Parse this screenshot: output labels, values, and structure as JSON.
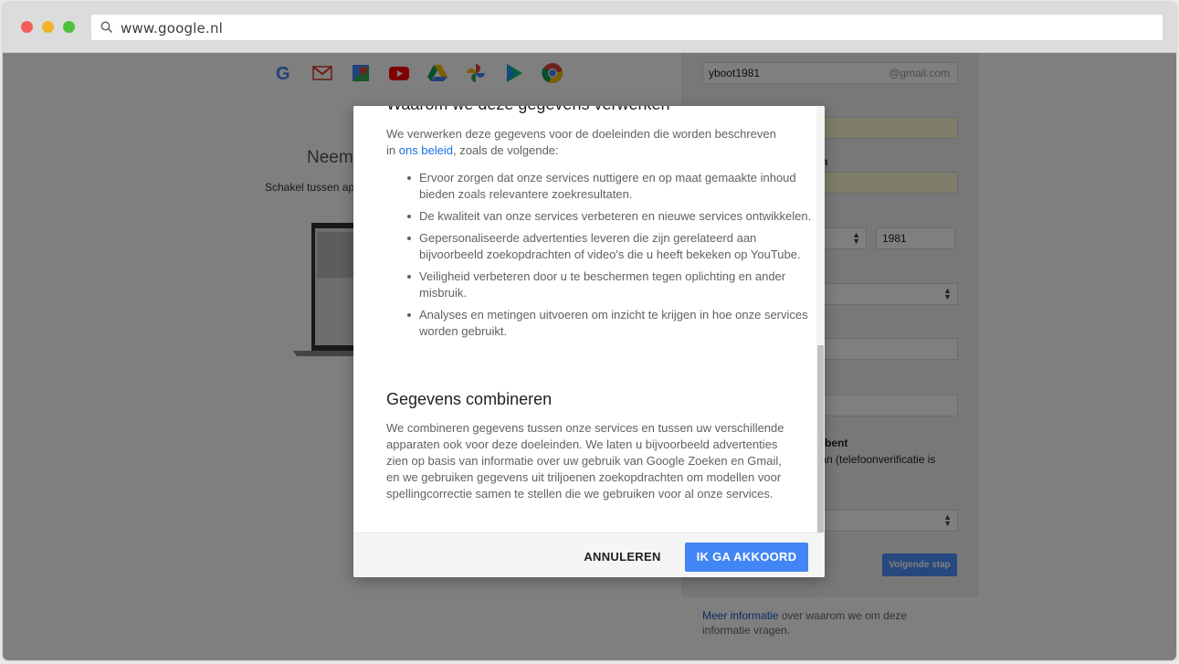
{
  "browser": {
    "url": "www.google.nl",
    "icons": [
      "close-dot",
      "minimize-dot",
      "zoom-dot",
      "search-icon"
    ]
  },
  "background_page": {
    "app_icons": [
      "google-icon",
      "gmail-icon",
      "maps-icon",
      "youtube-icon",
      "drive-icon",
      "photos-icon",
      "play-icon",
      "chrome-icon"
    ],
    "title_fragment": "Neem",
    "subtitle_fragment": "Schakel tussen ap",
    "form": {
      "username_value": "yboot1981",
      "username_suffix": "@gmail.com",
      "year_value": "1981",
      "label_fragment_1": "gen",
      "label_fragment_2": "bent",
      "phone_note_fragment": "slaan (telefoonverificatie is",
      "next_button": "Volgende stap"
    },
    "more_info_link": "Meer informatie",
    "more_info_text": " over waarom we om deze informatie vragen."
  },
  "dialog": {
    "cut_heading": "Waarom we deze gegevens verwerken",
    "intro_before": "We verwerken deze gegevens voor de doeleinden die worden beschreven in ",
    "intro_link": "ons beleid",
    "intro_after": ", zoals de volgende:",
    "purposes": [
      "Ervoor zorgen dat onze services nuttigere en op maat gemaakte inhoud bieden zoals relevantere zoekresultaten.",
      "De kwaliteit van onze services verbeteren en nieuwe services ontwikkelen.",
      "Gepersonaliseerde advertenties leveren die zijn gerelateerd aan bijvoorbeeld zoekopdrachten of video's die u heeft bekeken op YouTube.",
      "Veiligheid verbeteren door u te beschermen tegen oplichting en ander misbruik.",
      "Analyses en metingen uitvoeren om inzicht te krijgen in hoe onze services worden gebruikt."
    ],
    "section_heading": "Gegevens combineren",
    "section_text": "We combineren gegevens tussen onze services en tussen uw verschillende apparaten ook voor deze doeleinden. We laten u bijvoorbeeld advertenties zien op basis van informatie over uw gebruik van Google Zoeken en Gmail, en we gebruiken gegevens uit triljoenen zoekopdrachten om modellen voor spellingcorrectie samen te stellen die we gebruiken voor al onze services.",
    "cancel_button": "ANNULEREN",
    "accept_button": "IK GA AKKOORD"
  },
  "colors": {
    "accent": "#4285f4",
    "link": "#1a73e8",
    "overlay": "rgba(0,0,0,0.5)"
  }
}
